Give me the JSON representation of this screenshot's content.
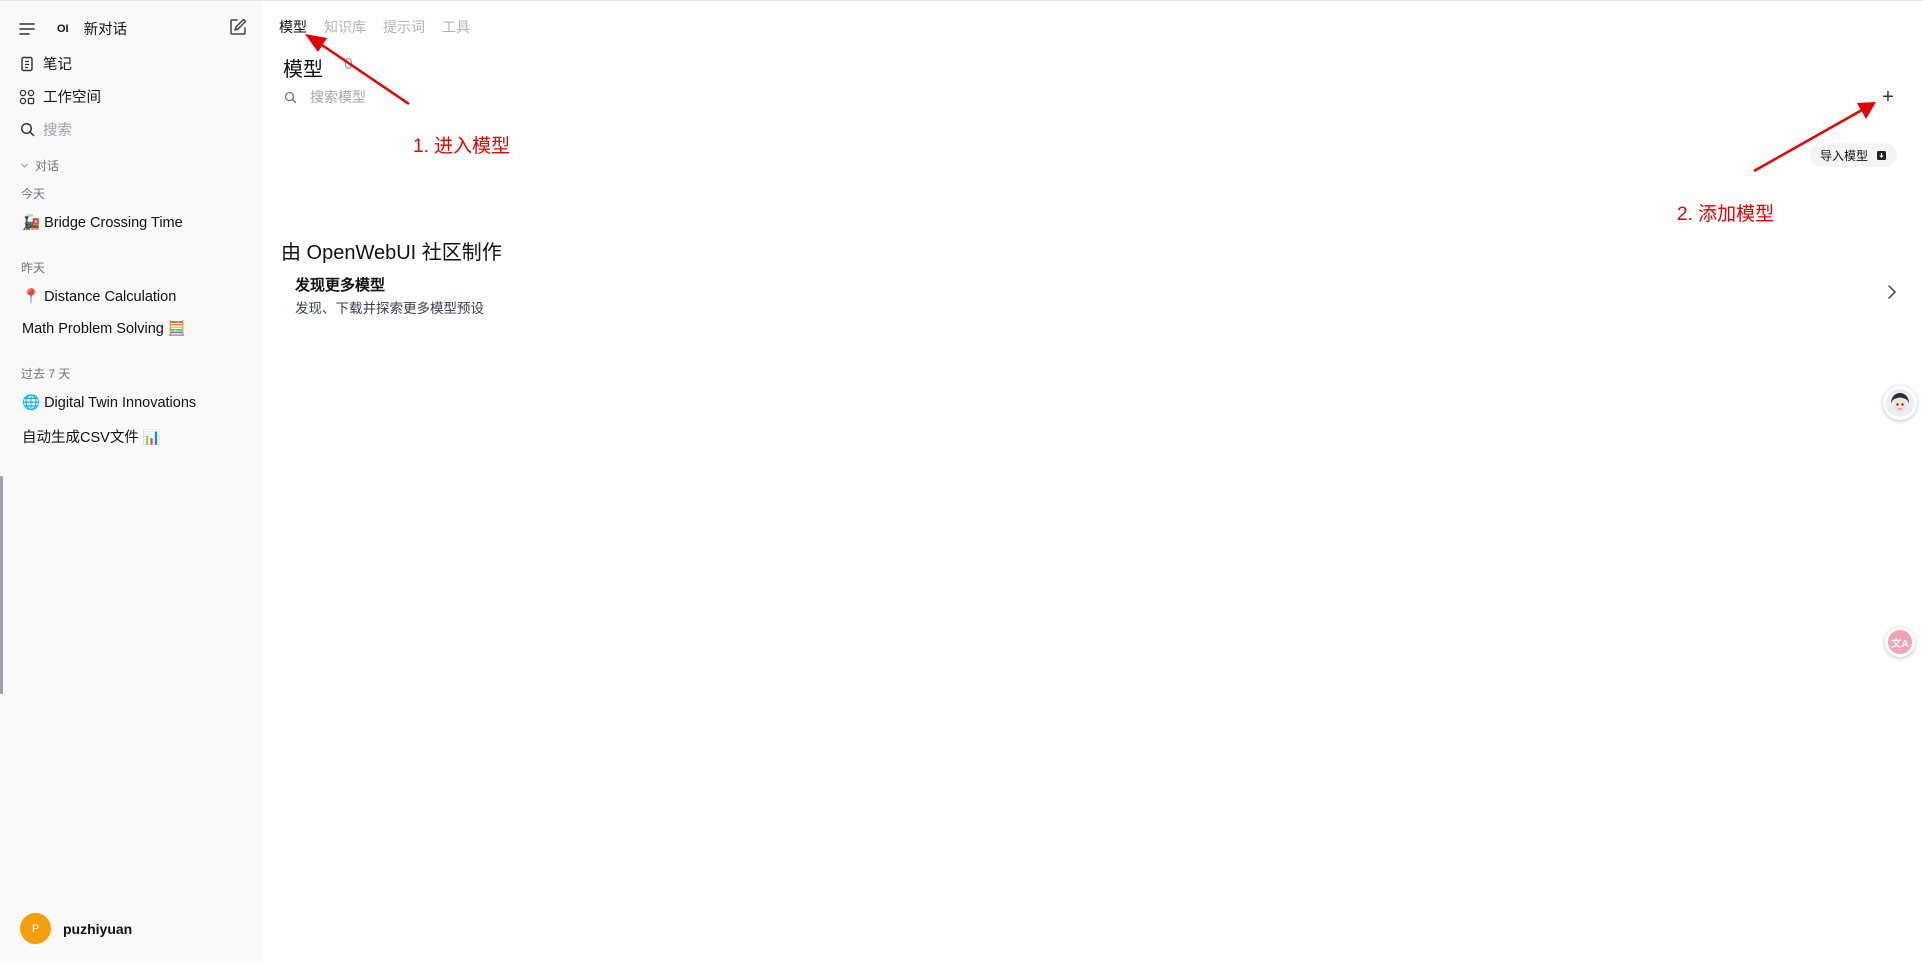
{
  "sidebar": {
    "brand": "OI",
    "new_chat": "新对话",
    "nav": {
      "notes": "笔记",
      "workspace": "工作空间",
      "search": "搜索"
    },
    "chats_section": "对话",
    "groups": [
      {
        "label": "今天",
        "chats": [
          "🚂 Bridge Crossing Time"
        ]
      },
      {
        "label": "昨天",
        "chats": [
          "📍 Distance Calculation",
          "Math Problem Solving 🧮"
        ]
      },
      {
        "label": "过去 7 天",
        "chats": [
          "🌐 Digital Twin Innovations",
          "自动生成CSV文件 📊"
        ]
      }
    ],
    "user": {
      "initial": "P",
      "name": "puzhiyuan"
    }
  },
  "tabs": [
    "模型",
    "知识库",
    "提示词",
    "工具"
  ],
  "models": {
    "title": "模型",
    "count": "0",
    "search_placeholder": "搜索模型",
    "add_symbol": "+",
    "import_label": "导入模型"
  },
  "community": {
    "title": "由 OpenWebUI 社区制作",
    "discover_title": "发现更多模型",
    "discover_subtitle": "发现、下载并探索更多模型预设"
  },
  "annotations": {
    "step1": "1. 进入模型",
    "step2": "2. 添加模型",
    "color": "#e60000"
  },
  "floating": {
    "translate_glyph": "文A"
  }
}
